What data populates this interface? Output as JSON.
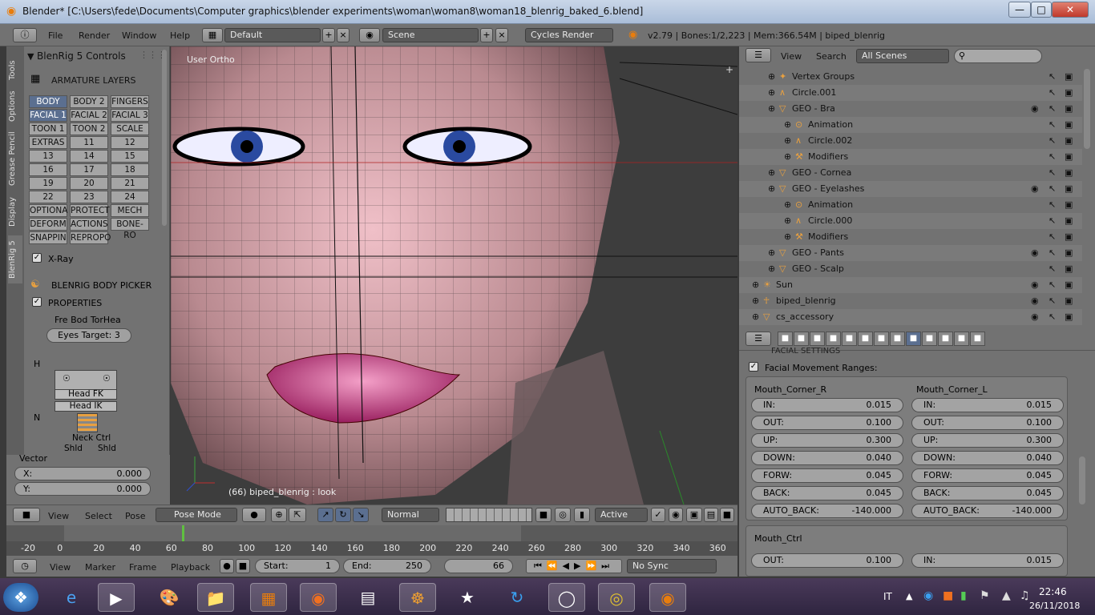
{
  "window": {
    "title": "Blender* [C:\\Users\\fede\\Documents\\Computer graphics\\blender experiments\\woman\\woman8\\woman18_blenrig_baked_6.blend]",
    "minimize": "—",
    "maximize": "□",
    "close": "✕"
  },
  "infobar": {
    "menus": [
      "File",
      "Render",
      "Window",
      "Help"
    ],
    "screen_layout": "Default",
    "scene": "Scene",
    "render_engine": "Cycles Render",
    "stats": "v2.79 | Bones:1/2,223 | Mem:366.54M | biped_blenrig"
  },
  "lefttabs": [
    "Tools",
    "Options",
    "Grease Pencil",
    "Display",
    "BlenRig 5"
  ],
  "blenrig": {
    "panel_title": "BlenRig 5 Controls",
    "armature_layers": "ARMATURE LAYERS",
    "layers": [
      [
        "BODY",
        "BODY 2",
        "FINGERS"
      ],
      [
        "FACIAL 1",
        "FACIAL 2",
        "FACIAL 3"
      ],
      [
        "TOON 1",
        "TOON 2",
        "SCALE"
      ],
      [
        "EXTRAS",
        "11",
        "12"
      ],
      [
        "13",
        "14",
        "15"
      ],
      [
        "16",
        "17",
        "18"
      ],
      [
        "19",
        "20",
        "21"
      ],
      [
        "22",
        "23",
        "24"
      ],
      [
        "OPTIONA",
        "PROTECT",
        "MECH"
      ],
      [
        "DEFORM",
        "ACTIONS",
        "BONE-RO"
      ],
      [
        "SNAPPIN",
        "REPROPO",
        ""
      ]
    ],
    "xray": "X-Ray",
    "body_picker": "BLENRIG BODY PICKER",
    "properties": "PROPERTIES",
    "picker_tabs": "Fre  Bod  TorHea",
    "eyes_target": "Eyes Target:  3",
    "labels": {
      "h": "H",
      "n": "N",
      "head_fk": "Head FK",
      "head_ik": "Head IK",
      "neck_ctrl": "Neck Ctrl",
      "shld_l": "Shld",
      "shld_r": "Shld"
    }
  },
  "vector": {
    "title": "Vector",
    "x_label": "X:",
    "x_value": "0.000",
    "y_label": "Y:",
    "y_value": "0.000"
  },
  "viewport": {
    "view_label": "User Ortho",
    "status": "(66) biped_blenrig : look"
  },
  "view3d_header": {
    "menus": [
      "View",
      "Select",
      "Pose"
    ],
    "mode": "Pose Mode",
    "pivot": "Normal",
    "active": "Active"
  },
  "timeline": {
    "ticks": [
      "-20",
      "0",
      "20",
      "40",
      "60",
      "80",
      "100",
      "120",
      "140",
      "160",
      "180",
      "200",
      "220",
      "240",
      "260",
      "280",
      "300",
      "320",
      "340",
      "360"
    ],
    "current_frame_percent": 0.135
  },
  "timeline_header": {
    "menus": [
      "View",
      "Marker",
      "Frame",
      "Playback"
    ],
    "start_label": "Start:",
    "start_value": "1",
    "end_label": "End:",
    "end_value": "250",
    "current": "66",
    "sync": "No Sync"
  },
  "outliner": {
    "menus": [
      "View",
      "Search"
    ],
    "filter": "All Scenes",
    "rows": [
      {
        "name": "Vertex Groups",
        "indent": 3,
        "icon": "✦"
      },
      {
        "name": "Circle.001",
        "indent": 3,
        "icon": "∧"
      },
      {
        "name": "GEO - Bra",
        "indent": 3,
        "icon": "▽",
        "eye": true
      },
      {
        "name": "Animation",
        "indent": 4,
        "icon": "⊙"
      },
      {
        "name": "Circle.002",
        "indent": 4,
        "icon": "∧"
      },
      {
        "name": "Modifiers",
        "indent": 4,
        "icon": "⚒"
      },
      {
        "name": "GEO - Cornea",
        "indent": 3,
        "icon": "▽"
      },
      {
        "name": "GEO - Eyelashes",
        "indent": 3,
        "icon": "▽",
        "eye": true
      },
      {
        "name": "Animation",
        "indent": 4,
        "icon": "⊙"
      },
      {
        "name": "Circle.000",
        "indent": 4,
        "icon": "∧"
      },
      {
        "name": "Modifiers",
        "indent": 4,
        "icon": "⚒"
      },
      {
        "name": "GEO - Pants",
        "indent": 3,
        "icon": "▽",
        "eye": true
      },
      {
        "name": "GEO - Scalp",
        "indent": 3,
        "icon": "▽"
      },
      {
        "name": "Sun",
        "indent": 2,
        "icon": "☀",
        "eye": true
      },
      {
        "name": "biped_blenrig",
        "indent": 2,
        "icon": "☥",
        "eye": true
      },
      {
        "name": "cs_accessory",
        "indent": 2,
        "icon": "▽",
        "eye": true
      }
    ]
  },
  "properties": {
    "section_cut": "FACIAL SETTINGS",
    "facial_movement": "Facial Movement Ranges:",
    "mouth_corner_r": "Mouth_Corner_R",
    "mouth_corner_l": "Mouth_Corner_L",
    "fields": [
      {
        "label": "IN:",
        "r": "0.015",
        "l": "0.015"
      },
      {
        "label": "OUT:",
        "r": "0.100",
        "l": "0.100"
      },
      {
        "label": "UP:",
        "r": "0.300",
        "l": "0.300"
      },
      {
        "label": "DOWN:",
        "r": "0.040",
        "l": "0.040"
      },
      {
        "label": "FORW:",
        "r": "0.045",
        "l": "0.045"
      },
      {
        "label": "BACK:",
        "r": "0.045",
        "l": "0.045"
      },
      {
        "label": "AUTO_BACK:",
        "r": "-140.000",
        "l": "-140.000"
      }
    ],
    "mouth_ctrl": "Mouth_Ctrl",
    "mc_out_label": "OUT:",
    "mc_out_value": "0.100",
    "mc_in_label": "IN:",
    "mc_in_value": "0.015"
  },
  "taskbar": {
    "lang": "IT",
    "time": "22:46",
    "date": "26/11/2018"
  }
}
